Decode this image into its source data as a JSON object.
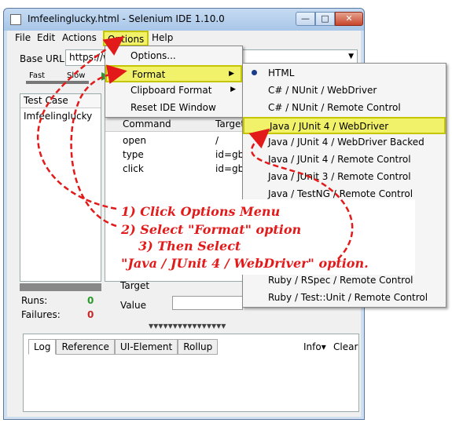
{
  "window": {
    "title": "Imfeelinglucky.html - Selenium IDE 1.10.0",
    "min_glyph": "—",
    "max_glyph": "□",
    "close_glyph": "✕"
  },
  "menubar": {
    "file": "File",
    "edit": "Edit",
    "actions": "Actions",
    "options": "Options",
    "help": "Help"
  },
  "base_url": {
    "label": "Base URL",
    "value": "https://w"
  },
  "speed": {
    "fast": "Fast",
    "slow": "Slow"
  },
  "testcase": {
    "header": "Test Case",
    "items": [
      "Imfeelinglucky"
    ]
  },
  "stats": {
    "runs_label": "Runs:",
    "runs": "0",
    "failures_label": "Failures:",
    "failures": "0"
  },
  "table": {
    "columns": [
      "Command",
      "Target"
    ],
    "rows": [
      [
        "open",
        "/"
      ],
      [
        "type",
        "id=gbq"
      ],
      [
        "click",
        "id=gbq"
      ]
    ]
  },
  "editor": {
    "target_label": "Target",
    "value_label": "Value"
  },
  "log": {
    "tabs": [
      "Log",
      "Reference",
      "UI-Element",
      "Rollup"
    ],
    "info": "Info▾",
    "clear": "Clear"
  },
  "options_menu": {
    "items": [
      "Options...",
      "Format",
      "Clipboard Format",
      "Reset IDE Window"
    ],
    "highlighted": "Format"
  },
  "format_menu": {
    "items": [
      "HTML",
      "C# / NUnit / WebDriver",
      "C# / NUnit / Remote Control",
      "Java / JUnit 4 / WebDriver",
      "Java / JUnit 4 / WebDriver Backed",
      "Java / JUnit 4 / Remote Control",
      "Java / JUnit 3 / Remote Control",
      "Java / TestNG / Remote Control",
      "Ruby / RSpec / Remote Control",
      "Ruby / Test::Unit / Remote Control"
    ],
    "selected": "HTML",
    "highlighted": "Java / JUnit 4 / WebDriver"
  },
  "annotation": {
    "lines": [
      "1) Click Options Menu",
      "2) Select \"Format\" option",
      "3) Then Select",
      "\"Java / JUnit 4 / WebDriver\" option."
    ],
    "color": "#e21a1a"
  }
}
